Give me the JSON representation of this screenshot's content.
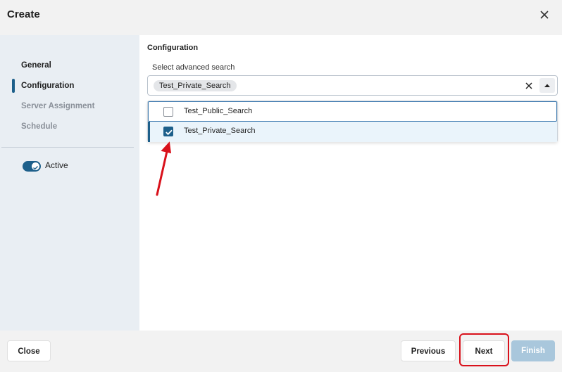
{
  "dialog": {
    "title": "Create"
  },
  "sidebar": {
    "items": [
      {
        "label": "General",
        "state": "normal"
      },
      {
        "label": "Configuration",
        "state": "active"
      },
      {
        "label": "Server Assignment",
        "state": "disabled"
      },
      {
        "label": "Schedule",
        "state": "disabled"
      }
    ],
    "active_toggle": {
      "label": "Active",
      "on": true
    }
  },
  "main": {
    "section_title": "Configuration",
    "field_label": "Select advanced search",
    "selected_chip": "Test_Private_Search",
    "options": [
      {
        "label": "Test_Public_Search",
        "checked": false
      },
      {
        "label": "Test_Private_Search",
        "checked": true
      }
    ]
  },
  "footer": {
    "close_label": "Close",
    "previous_label": "Previous",
    "next_label": "Next",
    "finish_label": "Finish"
  },
  "colors": {
    "accent": "#1d5f8a",
    "annotation": "#d9111b",
    "finish_disabled": "#a9c7dc"
  },
  "icons": {
    "close": "close-icon",
    "clear": "clear-icon",
    "caret": "caret-up-icon",
    "check": "checkmark-icon"
  }
}
